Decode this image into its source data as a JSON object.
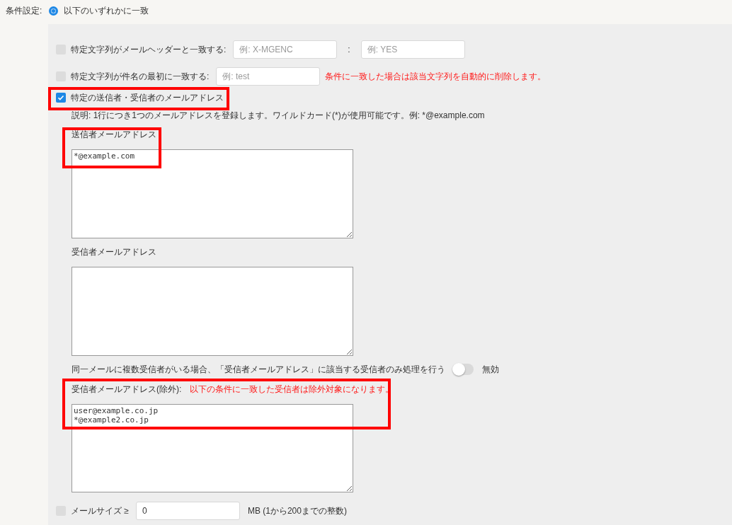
{
  "condition_setting": {
    "label": "条件設定:",
    "options": [
      {
        "label": "以下のいずれかに一致",
        "selected": true
      }
    ]
  },
  "conditions": [
    {
      "kind": "header",
      "checked": false,
      "label": "特定文字列がメールヘッダーと一致する:",
      "fields": [
        {
          "placeholder": "例: X-MGENC"
        },
        {
          "placeholder": "例: YES"
        }
      ],
      "separator": ":"
    },
    {
      "kind": "subject",
      "checked": false,
      "label": "特定文字列が件名の最初に一致する:",
      "field": {
        "placeholder": "例: test"
      },
      "note": "条件に一致した場合は該当文字列を自動的に削除します。"
    },
    {
      "kind": "address",
      "checked": true,
      "label": "特定の送信者・受信者のメールアドレス",
      "description": "説明: 1行につき1つのメールアドレスを登録します。ワイルドカード(*)が使用可能です。例: *@example.com",
      "sender": {
        "label": "送信者メールアドレス",
        "value": "*@example.com"
      },
      "recipient": {
        "label": "受信者メールアドレス"
      },
      "multi_recipient": {
        "label": "同一メールに複数受信者がいる場合、「受信者メールアドレス」に該当する受信者のみ処理を行う",
        "on": false,
        "state_label": "無効"
      },
      "excluded": {
        "label": "受信者メールアドレス(除外):",
        "note": "以下の条件に一致した受信者は除外対象になります。",
        "value": "user@example.co.jp\n*@example2.co.jp"
      }
    },
    {
      "kind": "size",
      "checked": false,
      "label": "メールサイズ ≥",
      "field": {
        "value": "0"
      },
      "unit": "MB (1から200までの整数)"
    }
  ]
}
